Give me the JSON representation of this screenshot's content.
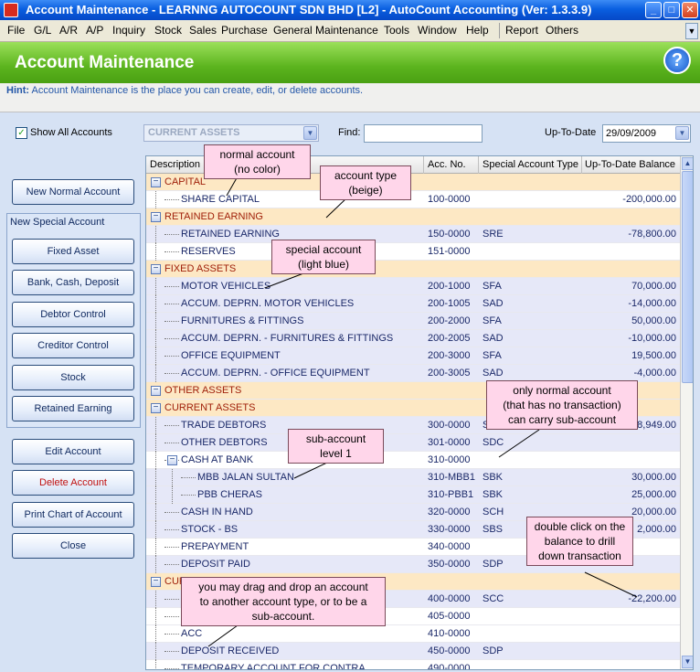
{
  "window": {
    "title": "Account Maintenance - LEARNNG AUTOCOUNT SDN BHD [L2] - AutoCount Accounting (Ver: 1.3.3.9)",
    "controls": [
      "_",
      "□",
      "✕"
    ]
  },
  "menu": [
    "File",
    "G/L",
    "A/R",
    "A/P",
    "Inquiry",
    "Stock",
    "Sales",
    "Purchase",
    "General Maintenance",
    "Tools",
    "Window",
    "Help",
    "Report",
    "Others"
  ],
  "header": {
    "title": "Account Maintenance",
    "help": "?"
  },
  "hint": {
    "label": "Hint:",
    "text": "Account Maintenance is the place you can create, edit, or delete accounts."
  },
  "filters": {
    "show_all_label": "Show All Accounts",
    "show_all_checked": "✓",
    "account_type_value": "CURRENT ASSETS",
    "find_label": "Find:",
    "find_value": "",
    "up_to_date_label": "Up-To-Date",
    "up_to_date_value": "29/09/2009"
  },
  "buttons": {
    "new_normal": "New Normal Account",
    "new_special_group": "New Special Account",
    "fixed_asset": "Fixed Asset",
    "bank_cash": "Bank, Cash, Deposit",
    "debtor": "Debtor Control",
    "creditor": "Creditor Control",
    "stock": "Stock",
    "retained": "Retained Earning",
    "edit": "Edit Account",
    "delete": "Delete Account",
    "print": "Print Chart of Account",
    "close": "Close"
  },
  "grid": {
    "columns": [
      "Description",
      "Acc. No.",
      "Special Account Type",
      "Up-To-Date Balance"
    ],
    "rows": [
      {
        "kind": "type",
        "desc": "CAPITAL",
        "acc": "",
        "sat": "",
        "bal": ""
      },
      {
        "kind": "normal",
        "desc": "SHARE CAPITAL",
        "acc": "100-0000",
        "sat": "",
        "bal": "-200,000.00"
      },
      {
        "kind": "type",
        "desc": "RETAINED EARNING",
        "acc": "",
        "sat": "",
        "bal": ""
      },
      {
        "kind": "special",
        "desc": "RETAINED EARNING",
        "acc": "150-0000",
        "sat": "SRE",
        "bal": "-78,800.00"
      },
      {
        "kind": "normal",
        "desc": "RESERVES",
        "acc": "151-0000",
        "sat": "",
        "bal": ""
      },
      {
        "kind": "type",
        "desc": "FIXED ASSETS",
        "acc": "",
        "sat": "",
        "bal": ""
      },
      {
        "kind": "special",
        "desc": "MOTOR VEHICLES",
        "acc": "200-1000",
        "sat": "SFA",
        "bal": "70,000.00"
      },
      {
        "kind": "special",
        "desc": "ACCUM. DEPRN. MOTOR VEHICLES",
        "acc": "200-1005",
        "sat": "SAD",
        "bal": "-14,000.00"
      },
      {
        "kind": "special",
        "desc": "FURNITURES & FITTINGS",
        "acc": "200-2000",
        "sat": "SFA",
        "bal": "50,000.00"
      },
      {
        "kind": "special",
        "desc": "ACCUM. DEPRN. - FURNITURES & FITTINGS",
        "acc": "200-2005",
        "sat": "SAD",
        "bal": "-10,000.00"
      },
      {
        "kind": "special",
        "desc": "OFFICE EQUIPMENT",
        "acc": "200-3000",
        "sat": "SFA",
        "bal": "19,500.00"
      },
      {
        "kind": "special",
        "desc": "ACCUM. DEPRN. - OFFICE EQUIPMENT",
        "acc": "200-3005",
        "sat": "SAD",
        "bal": "-4,000.00"
      },
      {
        "kind": "type",
        "desc": "OTHER ASSETS",
        "acc": "",
        "sat": "",
        "bal": ""
      },
      {
        "kind": "type",
        "desc": "CURRENT ASSETS",
        "acc": "",
        "sat": "",
        "bal": ""
      },
      {
        "kind": "special",
        "desc": "TRADE DEBTORS",
        "acc": "300-0000",
        "sat": "SI",
        "bal": "68,949.00"
      },
      {
        "kind": "special",
        "desc": "OTHER DEBTORS",
        "acc": "301-0000",
        "sat": "SDC",
        "bal": ""
      },
      {
        "kind": "normal",
        "desc": "CASH AT BANK",
        "acc": "310-0000",
        "sat": "",
        "bal": ""
      },
      {
        "kind": "special",
        "desc": "MBB JALAN SULTAN",
        "acc": "310-MBB1",
        "sat": "SBK",
        "bal": "30,000.00"
      },
      {
        "kind": "special",
        "desc": "PBB CHERAS",
        "acc": "310-PBB1",
        "sat": "SBK",
        "bal": "25,000.00"
      },
      {
        "kind": "special",
        "desc": "CASH IN HAND",
        "acc": "320-0000",
        "sat": "SCH",
        "bal": "20,000.00"
      },
      {
        "kind": "special",
        "desc": "STOCK - BS",
        "acc": "330-0000",
        "sat": "SBS",
        "bal": "2,000.00"
      },
      {
        "kind": "normal",
        "desc": "PREPAYMENT",
        "acc": "340-0000",
        "sat": "",
        "bal": ""
      },
      {
        "kind": "special",
        "desc": "DEPOSIT PAID",
        "acc": "350-0000",
        "sat": "SDP",
        "bal": ""
      },
      {
        "kind": "type",
        "desc": "CURRENT LIABILITIES",
        "acc": "",
        "sat": "",
        "bal": ""
      },
      {
        "kind": "special",
        "desc": "",
        "acc": "400-0000",
        "sat": "SCC",
        "bal": "-22,200.00"
      },
      {
        "kind": "normal",
        "desc": "",
        "acc": "405-0000",
        "sat": "",
        "bal": ""
      },
      {
        "kind": "normal",
        "desc": "ACC",
        "acc": "410-0000",
        "sat": "",
        "bal": ""
      },
      {
        "kind": "special",
        "desc": "DEPOSIT RECEIVED",
        "acc": "450-0000",
        "sat": "SDP",
        "bal": ""
      },
      {
        "kind": "normal",
        "desc": "TEMPORARY ACCOUNT FOR CONTRA",
        "acc": "490-0000",
        "sat": "",
        "bal": ""
      }
    ]
  },
  "callouts": {
    "normal": "normal account\n(no color)",
    "type": "account type\n(beige)",
    "special": "special account\n(light blue)",
    "subaccount_rule": "only normal account\n(that has no transaction)\ncan carry sub-account",
    "sub_level": "sub-account\nlevel 1",
    "drill": "double click on the\nbalance to drill\ndown transaction",
    "drag": "you may drag and drop an account\nto another account type, or to be a\nsub-account."
  },
  "colors": {
    "type_row": "#fde8c4",
    "special_row": "#e6e8f8",
    "normal_row": "#ffffff",
    "header_green": "#5cb41e",
    "callout": "#ffd6ea"
  }
}
